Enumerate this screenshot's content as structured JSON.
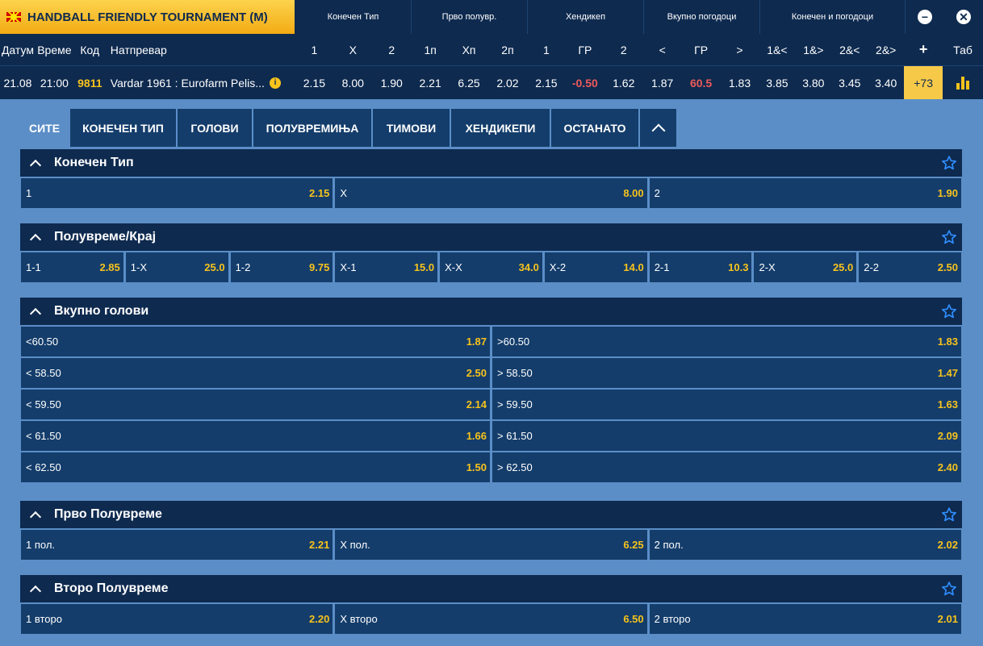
{
  "header": {
    "tournament": "HANDBALL FRIENDLY TOURNAMENT (M)",
    "groups": [
      "Конечен Тип",
      "Прво полувр.",
      "Хендикеп",
      "Вкупно погодоци",
      "Конечен и погодоци"
    ],
    "minus_label": "−",
    "close_label": "✕",
    "columns": {
      "date": "Датум",
      "time": "Време",
      "code": "Код",
      "match": "Натпревар",
      "odds": [
        "1",
        "X",
        "2",
        "1п",
        "Xп",
        "2п",
        "1",
        "ГР",
        "2",
        "<",
        "ГР",
        ">",
        "1&<",
        "1&>",
        "2&<",
        "2&>"
      ],
      "plus": "+",
      "tab": "Таб"
    },
    "match_row": {
      "date": "21.08",
      "time": "21:00",
      "code": "9811",
      "match": "Vardar 1961 : Eurofarm Pelis...",
      "info_icon": "i",
      "odds": [
        "2.15",
        "8.00",
        "1.90",
        "2.21",
        "6.25",
        "2.02",
        "2.15",
        "-0.50",
        "1.62",
        "1.87",
        "60.5",
        "1.83",
        "3.85",
        "3.80",
        "3.45",
        "3.40"
      ],
      "more": "+73"
    }
  },
  "tabs": [
    "СИТЕ",
    "КОНЕЧЕН ТИП",
    "ГОЛОВИ",
    "ПОЛУВРЕМИЊА",
    "ТИМОВИ",
    "ХЕНДИКЕПИ",
    "ОСТАНАТО"
  ],
  "sections": [
    {
      "title": "Конечен Тип",
      "rows": [
        [
          [
            "1",
            "2.15"
          ],
          [
            "X",
            "8.00"
          ],
          [
            "2",
            "1.90"
          ]
        ]
      ]
    },
    {
      "title": "Полувреме/Крај",
      "rows": [
        [
          [
            "1-1",
            "2.85"
          ],
          [
            "1-X",
            "25.0"
          ],
          [
            "1-2",
            "9.75"
          ],
          [
            "X-1",
            "15.0"
          ],
          [
            "X-X",
            "34.0"
          ],
          [
            "X-2",
            "14.0"
          ],
          [
            "2-1",
            "10.3"
          ],
          [
            "2-X",
            "25.0"
          ],
          [
            "2-2",
            "2.50"
          ]
        ]
      ]
    },
    {
      "title": "Вкупно голови",
      "rows": [
        [
          [
            "<60.50",
            "1.87"
          ],
          [
            ">60.50",
            "1.83"
          ]
        ],
        [
          [
            "< 58.50",
            "2.50"
          ],
          [
            "> 58.50",
            "1.47"
          ]
        ],
        [
          [
            "< 59.50",
            "2.14"
          ],
          [
            "> 59.50",
            "1.63"
          ]
        ],
        [
          [
            "< 61.50",
            "1.66"
          ],
          [
            "> 61.50",
            "2.09"
          ]
        ],
        [
          [
            "< 62.50",
            "1.50"
          ],
          [
            "> 62.50",
            "2.40"
          ]
        ]
      ]
    },
    {
      "title": "Прво Полувреме",
      "rows": [
        [
          [
            "1 пол.",
            "2.21"
          ],
          [
            "X пол.",
            "6.25"
          ],
          [
            "2 пол.",
            "2.02"
          ]
        ]
      ]
    },
    {
      "title": "Второ Полувреме",
      "rows": [
        [
          [
            "1 второ",
            "2.20"
          ],
          [
            "X второ",
            "6.50"
          ],
          [
            "2 второ",
            "2.01"
          ]
        ]
      ]
    }
  ],
  "colors": {
    "navy": "#0e2a4f",
    "tile": "#143d6b",
    "bg": "#5b8ec7",
    "accent": "#f7c31c",
    "negative": "#ee5a5a"
  }
}
